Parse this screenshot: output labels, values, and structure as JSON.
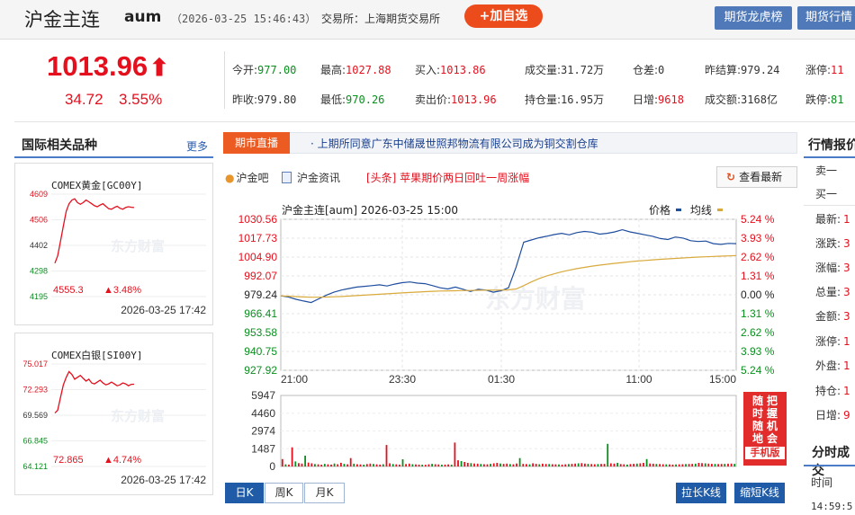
{
  "header": {
    "title": "沪金主连",
    "code": "aum",
    "datetime": "（2026-03-25 15:46:43）",
    "exchange": "交易所：上海期货交易所",
    "add_button": "+加自选",
    "buttons": [
      "期货龙虎榜",
      "期货行情"
    ]
  },
  "quote": {
    "price": "1013.96",
    "arrow": "⬆",
    "change": "34.72",
    "change_pct": "3.55%"
  },
  "stats": [
    [
      {
        "label": "今开:",
        "value": "977.00",
        "color": "green"
      },
      {
        "label": "最高:",
        "value": "1027.88",
        "color": "red"
      },
      {
        "label": "买入:",
        "value": "1013.86",
        "color": "red"
      },
      {
        "label": "成交量:",
        "value": "31.72万",
        "color": "dark"
      },
      {
        "label": "仓差:",
        "value": "0",
        "color": "dark"
      },
      {
        "label": "昨结算:",
        "value": "979.24",
        "color": "dark"
      },
      {
        "label": "涨停:",
        "value": "11",
        "color": "red"
      }
    ],
    [
      {
        "label": "昨收:",
        "value": "979.80",
        "color": "dark"
      },
      {
        "label": "最低:",
        "value": "970.26",
        "color": "green"
      },
      {
        "label": "卖出价:",
        "value": "1013.96",
        "color": "red"
      },
      {
        "label": "持仓量:",
        "value": "16.95万",
        "color": "dark"
      },
      {
        "label": "日增:",
        "value": "9618",
        "color": "red"
      },
      {
        "label": "成交额:",
        "value": "3168亿",
        "color": "dark"
      },
      {
        "label": "跌停:",
        "value": "81",
        "color": "green"
      }
    ]
  ],
  "intl": {
    "title": "国际相关品种",
    "more": "更多",
    "watermark": "东方财富",
    "minis": [
      {
        "name": "COMEX黄金[GC00Y]",
        "y_ticks": [
          "4609",
          "4506",
          "4402",
          "4298",
          "4195"
        ],
        "last": "4555.3",
        "change": "▲3.48%",
        "time": "2026-03-25  17:42",
        "chart_data": {
          "type": "line",
          "ylim": [
            4195,
            4609
          ],
          "values": [
            4330,
            4360,
            4420,
            4480,
            4540,
            4570,
            4585,
            4590,
            4575,
            4568,
            4575,
            4585,
            4578,
            4570,
            4562,
            4558,
            4565,
            4570,
            4560,
            4550,
            4548,
            4555,
            4560,
            4552,
            4548,
            4555,
            4558,
            4556,
            4555
          ]
        }
      },
      {
        "name": "COMEX白银[SI00Y]",
        "y_ticks": [
          "75.017",
          "72.293",
          "69.569",
          "66.845",
          "64.121"
        ],
        "last": "72.865",
        "change": "▲4.74%",
        "time": "2026-03-25  17:42",
        "chart_data": {
          "type": "line",
          "ylim": [
            64.121,
            75.017
          ],
          "values": [
            69.8,
            70.1,
            71.5,
            72.8,
            73.6,
            74.2,
            73.9,
            73.4,
            73.6,
            73.8,
            73.5,
            73.2,
            73.4,
            73.0,
            72.9,
            73.1,
            73.3,
            73.0,
            72.8,
            72.9,
            73.1,
            72.9,
            72.7,
            72.8,
            73.0,
            72.9,
            72.7,
            72.86,
            72.865
          ]
        }
      }
    ]
  },
  "news": {
    "tag": "期市直播",
    "text": "· 上期所同意广东中储晟世照邦物流有限公司成为铜交割仓库"
  },
  "links": {
    "forum": "沪金吧",
    "news": "沪金资讯",
    "headline": "[头条] 苹果期价两日回吐一周涨幅",
    "refresh": "查看最新"
  },
  "chart": {
    "title": "沪金主连[aum]  2026-03-25  15:00",
    "legend_price": "价格",
    "legend_avg": "均线",
    "watermark": "东方财富",
    "mobile_ad": [
      "随",
      "时",
      "随",
      "地",
      "把",
      "握",
      "机",
      "会",
      "手机版"
    ],
    "colors": {
      "price": "#1f4e9e",
      "avg": "#d9a93b",
      "up": "#e4101d",
      "down": "#0b8e1f"
    }
  },
  "chart_data": {
    "type": "line",
    "title": "沪金主连[aum]  2026-03-25  15:00",
    "ylim": [
      927.92,
      1030.56
    ],
    "y_ticks": [
      "1030.56",
      "1017.73",
      "1004.90",
      "992.07",
      "979.24",
      "966.41",
      "953.58",
      "940.75",
      "927.92"
    ],
    "pct_ticks": [
      "5.24 %",
      "3.93 %",
      "2.62 %",
      "1.31 %",
      "0.00 %",
      "1.31 %",
      "2.62 %",
      "3.93 %",
      "5.24 %"
    ],
    "x_ticks": [
      "21:00",
      "23:30",
      "01:30",
      "11:00",
      "15:00"
    ],
    "reference": 979.24,
    "series": [
      {
        "name": "价格",
        "values": [
          978.5,
          977.8,
          976.2,
          975.0,
          974.0,
          976.5,
          979.0,
          981.0,
          982.5,
          983.5,
          984.5,
          985.0,
          985.5,
          986.0,
          985.2,
          986.5,
          987.5,
          988.0,
          987.2,
          986.8,
          985.5,
          984.0,
          983.2,
          984.5,
          983.0,
          981.5,
          983.0,
          982.5,
          981.0,
          982.0,
          984.0,
          998.0,
          1015.0,
          1016.5,
          1018.0,
          1019.0,
          1020.2,
          1021.0,
          1020.0,
          1021.5,
          1022.3,
          1021.8,
          1020.5,
          1021.0,
          1022.0,
          1023.5,
          1022.0,
          1021.0,
          1020.0,
          1019.0,
          1017.5,
          1016.8,
          1018.5,
          1017.8,
          1016.0,
          1015.5,
          1015.8,
          1014.0,
          1013.5,
          1014.2,
          1014.0
        ]
      },
      {
        "name": "均线",
        "values": [
          978.5,
          978.3,
          978.0,
          977.8,
          977.6,
          977.6,
          977.7,
          977.9,
          978.1,
          978.4,
          978.7,
          979.0,
          979.3,
          979.6,
          979.9,
          980.2,
          980.5,
          980.8,
          981.1,
          981.4,
          981.6,
          981.8,
          981.9,
          982.0,
          982.1,
          982.2,
          982.3,
          982.4,
          982.4,
          982.5,
          982.6,
          983.2,
          985.5,
          988.0,
          990.2,
          992.0,
          993.5,
          994.9,
          996.0,
          997.0,
          997.9,
          998.7,
          999.4,
          1000.0,
          1000.6,
          1001.2,
          1001.7,
          1002.2,
          1002.6,
          1003.0,
          1003.4,
          1003.7,
          1004.0,
          1004.3,
          1004.6,
          1004.9,
          1005.1,
          1005.3,
          1005.5,
          1005.7,
          1005.9
        ]
      }
    ],
    "volume": {
      "ylim": [
        0,
        5947
      ],
      "y_ticks": [
        "5947",
        "4460",
        "2974",
        "1487",
        "0"
      ],
      "values": [
        620,
        180,
        160,
        1600,
        420,
        280,
        240,
        900,
        320,
        260,
        200,
        180,
        150,
        220,
        180,
        160,
        250,
        190,
        310,
        220,
        180,
        700,
        230,
        190,
        170,
        150,
        200,
        240,
        210,
        180,
        160,
        190,
        1800,
        260,
        200,
        180,
        160,
        600,
        200,
        240,
        190,
        170,
        160,
        150,
        140,
        180,
        220,
        190,
        170,
        150,
        160,
        170,
        150,
        2000,
        520,
        450,
        380,
        300,
        280,
        250,
        230,
        210,
        190,
        180,
        220,
        260,
        300,
        250,
        220,
        240,
        200,
        180,
        250,
        700,
        220,
        200,
        180,
        260,
        220,
        190,
        230,
        210,
        200,
        190,
        180,
        170,
        160,
        180,
        200,
        220,
        240,
        260,
        280,
        240,
        220,
        200,
        190,
        200,
        210,
        220,
        1900,
        260,
        240,
        300,
        200,
        180,
        160,
        200,
        220,
        240,
        260,
        300,
        620,
        250,
        230,
        210,
        200,
        190,
        180,
        170,
        160,
        170,
        180,
        190,
        200,
        210,
        220,
        230,
        300,
        280,
        260,
        240,
        220,
        210,
        200,
        210,
        220,
        230,
        240,
        220
      ]
    }
  },
  "tabs": [
    "日K",
    "周K",
    "月K"
  ],
  "kline_buttons": [
    "拉长K线",
    "缩短K线"
  ],
  "right": {
    "title": "行情报价",
    "rows": [
      {
        "label": "卖一",
        "value": ""
      },
      {
        "label": "买一",
        "value": ""
      },
      {
        "label": "最新:",
        "value": "1"
      },
      {
        "label": "涨跌:",
        "value": "3"
      },
      {
        "label": "涨幅:",
        "value": "3"
      },
      {
        "label": "总量:",
        "value": "3"
      },
      {
        "label": "金额:",
        "value": "3"
      },
      {
        "label": "涨停:",
        "value": "1"
      },
      {
        "label": "外盘:",
        "value": "1"
      },
      {
        "label": "持仓:",
        "value": "1"
      },
      {
        "label": "日增:",
        "value": "9"
      }
    ],
    "title2": "分时成交",
    "time_header": "时间",
    "first_time": "14:59:5"
  }
}
